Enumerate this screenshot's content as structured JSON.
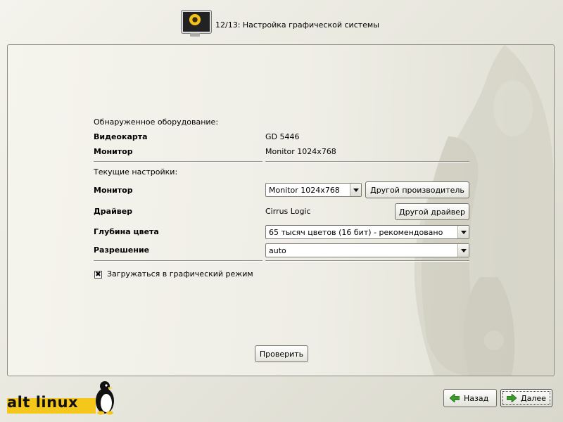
{
  "header": {
    "title": "12/13: Настройка графической системы",
    "icon": "monitor-icon"
  },
  "detected": {
    "heading": "Обнаруженное оборудование:",
    "rows": [
      {
        "label": "Видеокарта",
        "value": "GD 5446"
      },
      {
        "label": "Монитор",
        "value": "Monitor 1024x768"
      }
    ]
  },
  "current": {
    "heading": "Текущие настройки:",
    "monitor": {
      "label": "Монитор",
      "value": "Monitor 1024x768",
      "button": "Другой производитель"
    },
    "driver": {
      "label": "Драйвер",
      "value": "Cirrus Logic",
      "button": "Другой драйвер"
    },
    "depth": {
      "label": "Глубина цвета",
      "value": "65 тысяч цветов (16 бит) - рекомендовано"
    },
    "resolution": {
      "label": "Разрешение",
      "value": "auto"
    }
  },
  "boot_graphic": {
    "label": "Загружаться в графический режим",
    "checked": true,
    "mark": "✖"
  },
  "test_button": "Проверить",
  "logo": {
    "text": "alt linux"
  },
  "nav": {
    "back": "Назад",
    "next": "Далее"
  },
  "colors": {
    "logo_yellow": "#f5c71a",
    "arrow_green": "#3a9a2a"
  }
}
